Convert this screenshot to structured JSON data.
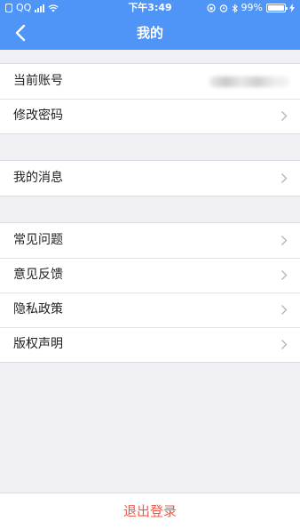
{
  "status_bar": {
    "carrier": "QQ",
    "time": "下午3:49",
    "battery": "99%"
  },
  "navbar": {
    "title": "我的",
    "back_icon": "chevron-left-icon"
  },
  "groups": [
    {
      "items": [
        {
          "label": "当前账号",
          "has_chevron": false
        },
        {
          "label": "修改密码",
          "has_chevron": true
        }
      ]
    },
    {
      "items": [
        {
          "label": "我的消息",
          "has_chevron": true
        }
      ]
    },
    {
      "items": [
        {
          "label": "常见问题",
          "has_chevron": true
        },
        {
          "label": "意见反馈",
          "has_chevron": true
        },
        {
          "label": "隐私政策",
          "has_chevron": true
        },
        {
          "label": "版权声明",
          "has_chevron": true
        }
      ]
    }
  ],
  "logout_label": "退出登录",
  "colors": {
    "primary": "#4e95f7",
    "danger": "#f05a4a",
    "background": "#efeff4"
  }
}
